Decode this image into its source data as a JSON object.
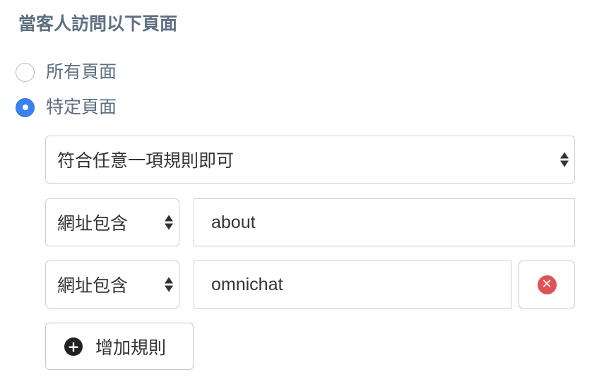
{
  "section": {
    "heading": "當客人訪問以下頁面"
  },
  "scope_options": [
    {
      "label": "所有頁面",
      "checked": false
    },
    {
      "label": "特定頁面",
      "checked": true
    }
  ],
  "match_mode": {
    "selected": "符合任意一項規則即可"
  },
  "rules": [
    {
      "operator": "網址包含",
      "value": "about",
      "removable": false
    },
    {
      "operator": "網址包含",
      "value": "omnichat",
      "removable": true
    }
  ],
  "add_rule": {
    "label": "增加規則",
    "icon": "plus-circle-icon"
  },
  "icons": {
    "remove": "remove-circle-icon",
    "select_arrows": "select-arrows-icon"
  },
  "colors": {
    "heading": "#5f6f81",
    "radio_checked": "#3b82f0",
    "remove_icon": "#e05252"
  }
}
